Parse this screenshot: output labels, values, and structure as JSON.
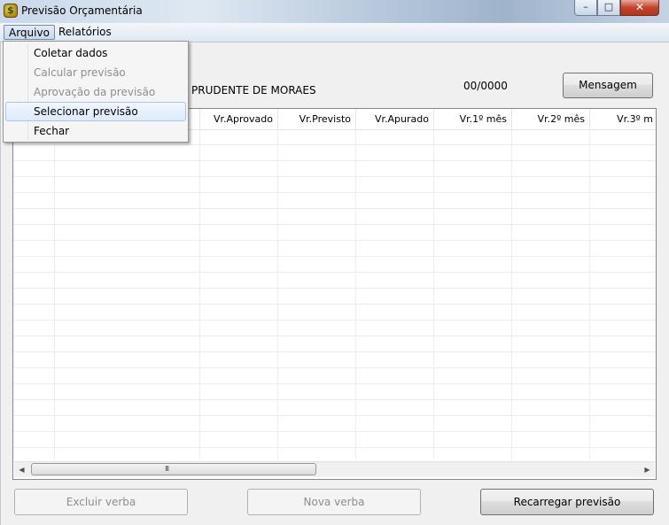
{
  "window": {
    "title": "Previsão Orçamentária",
    "controls": {
      "minimize": "–",
      "maximize": "□",
      "close": "✕"
    }
  },
  "menubar": {
    "items": [
      "Arquivo",
      "Relatórios"
    ]
  },
  "arquivo_menu": {
    "items": [
      {
        "label": "Coletar dados",
        "enabled": true
      },
      {
        "label": "Calcular previsão",
        "enabled": false
      },
      {
        "label": "Aprovação da previsão",
        "enabled": false
      },
      {
        "label": "Selecionar previsão",
        "enabled": true,
        "highlighted": true
      },
      {
        "label": "Fechar",
        "enabled": true
      }
    ]
  },
  "header": {
    "name": "PRUDENTE DE MORAES",
    "code": "00/0000",
    "mensagem_label": "Mensagem"
  },
  "grid": {
    "columns": [
      "Vr.Aprovado",
      "Vr.Previsto",
      "Vr.Apurado",
      "Vr.1º mês",
      "Vr.2º mês",
      "Vr.3º m"
    ],
    "rows": [],
    "scroll_grip": "III"
  },
  "footer": {
    "excluir_label": "Excluir verba",
    "nova_label": "Nova verba",
    "recarregar_label": "Recarregar previsão"
  },
  "colors": {
    "highlight": "#dceafb",
    "disabled_text": "#8d8d8d",
    "close_button": "#c4432b"
  }
}
